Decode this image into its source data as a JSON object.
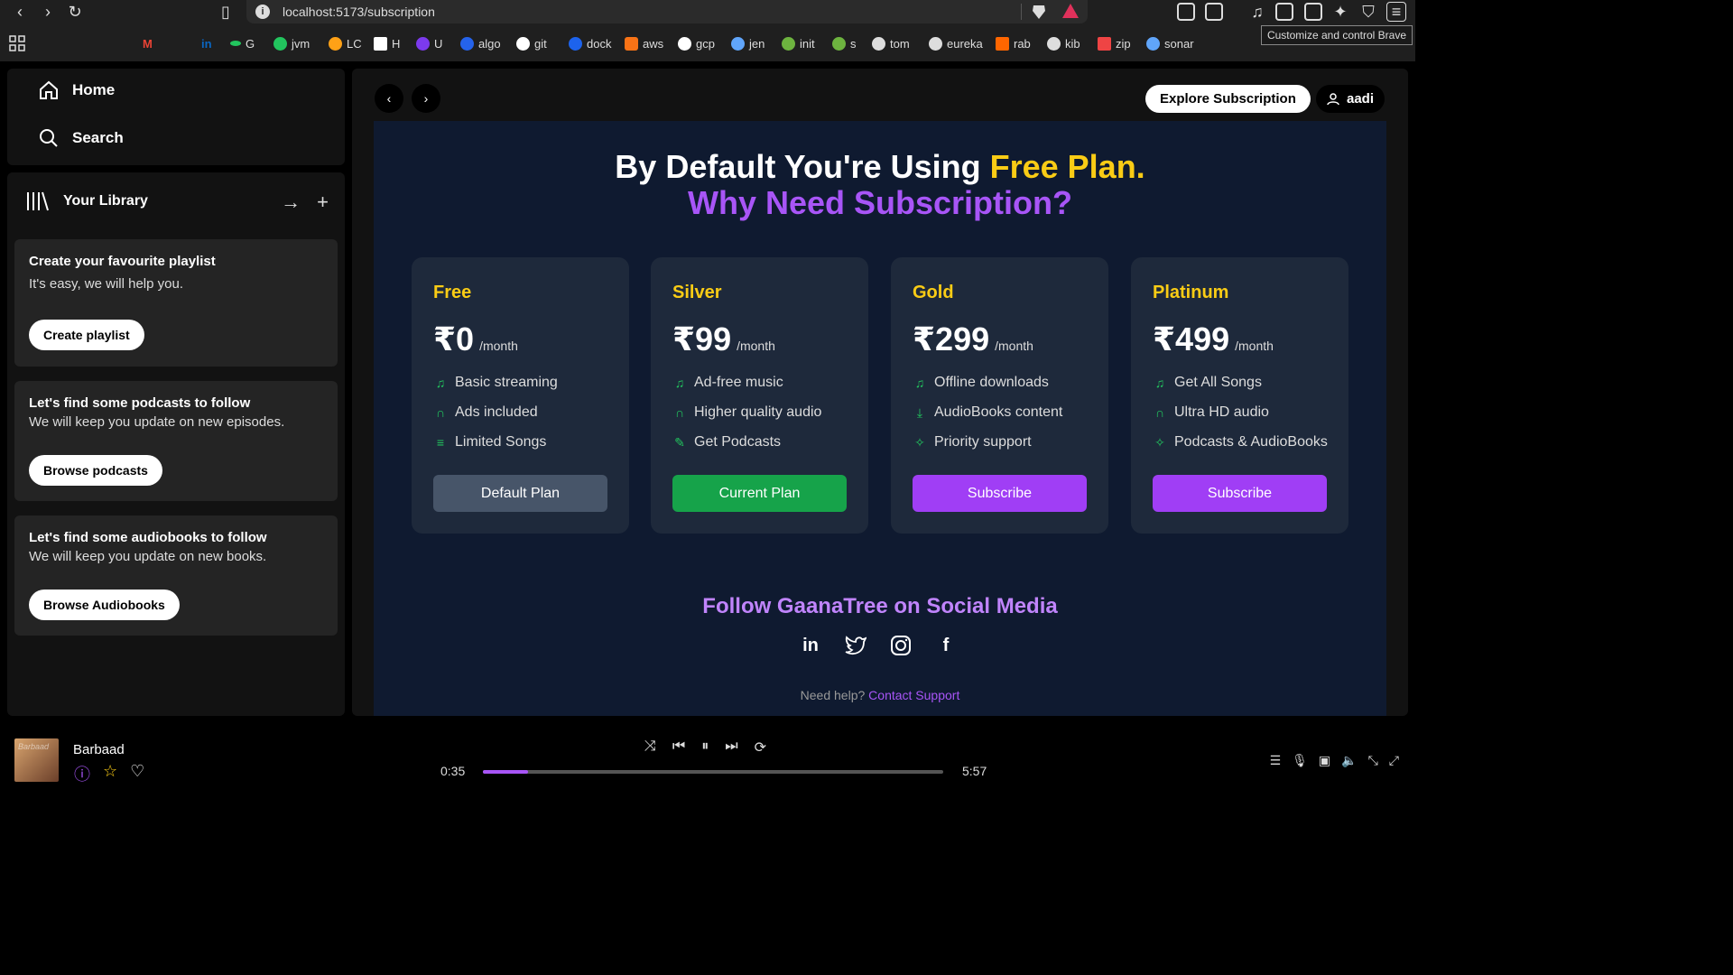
{
  "browser": {
    "url": "localhost:5173/subscription",
    "tooltip": "Customize and control Brave",
    "bookmarks": [
      {
        "label": "G",
        "color": "#ffffff"
      },
      {
        "label": "jvm",
        "color": "#22c55e"
      },
      {
        "label": "LC",
        "color": "#ffa116"
      },
      {
        "label": "H",
        "color": "#ffffff"
      },
      {
        "label": "U",
        "color": "#7c3aed"
      },
      {
        "label": "algo",
        "color": "#2563eb"
      },
      {
        "label": "git",
        "color": "#ffffff"
      },
      {
        "label": "dock",
        "color": "#1d63ed"
      },
      {
        "label": "aws",
        "color": "#f97316"
      },
      {
        "label": "gcp",
        "color": "#ffffff"
      },
      {
        "label": "jen",
        "color": "#60a5fa"
      },
      {
        "label": "init",
        "color": "#6db33f"
      },
      {
        "label": "s",
        "color": "#6db33f"
      },
      {
        "label": "tom",
        "color": "#dddddd"
      },
      {
        "label": "eureka",
        "color": "#dddddd"
      },
      {
        "label": "rab",
        "color": "#ff6600"
      },
      {
        "label": "kib",
        "color": "#dddddd"
      },
      {
        "label": "zip",
        "color": "#ef4444"
      },
      {
        "label": "sonar",
        "color": "#60a5fa"
      }
    ]
  },
  "sidebar": {
    "home_label": "Home",
    "search_label": "Search",
    "library_label": "Your Library",
    "cards": [
      {
        "title": "Create your favourite playlist",
        "subtitle": "It's easy, we will help you.",
        "button": "Create playlist"
      },
      {
        "title": "Let's find some podcasts to follow",
        "subtitle": "We will keep you update on new episodes.",
        "button": "Browse podcasts"
      },
      {
        "title": "Let's find some audiobooks to follow",
        "subtitle": "We will keep you update on new books.",
        "button": "Browse Audiobooks"
      }
    ]
  },
  "header": {
    "explore_label": "Explore Subscription",
    "user_label": "aadi"
  },
  "hero": {
    "line1_prefix": "By Default You're Using ",
    "line1_highlight": "Free Plan.",
    "line2": "Why Need Subscription?"
  },
  "plans": [
    {
      "name": "Free",
      "price": "₹0",
      "per": "/month",
      "features": [
        "Basic streaming",
        "Ads included",
        "Limited Songs"
      ],
      "button": "Default Plan",
      "button_color": "#475569"
    },
    {
      "name": "Silver",
      "price": "₹99",
      "per": "/month",
      "features": [
        "Ad-free music",
        "Higher quality audio",
        "Get Podcasts"
      ],
      "button": "Current Plan",
      "button_color": "#16a34a"
    },
    {
      "name": "Gold",
      "price": "₹299",
      "per": "/month",
      "features": [
        "Offline downloads",
        "AudioBooks content",
        "Priority support"
      ],
      "button": "Subscribe",
      "button_color": "#a03ef5"
    },
    {
      "name": "Platinum",
      "price": "₹499",
      "per": "/month",
      "features": [
        "Get All Songs",
        "Ultra HD audio",
        "Podcasts & AudioBooks"
      ],
      "button": "Subscribe",
      "button_color": "#a03ef5"
    }
  ],
  "social": {
    "heading": "Follow GaanaTree on Social Media",
    "help_text": "Need help?",
    "help_link": "Contact Support"
  },
  "player": {
    "song_title": "Barbaad",
    "cover_text": "Barbaad",
    "current_time": "0:35",
    "total_time": "5:57",
    "progress_fraction": 0.098
  },
  "colors": {
    "accent_purple": "#a855f7",
    "highlight_yellow": "#facc15",
    "feature_green": "#22c55e"
  }
}
